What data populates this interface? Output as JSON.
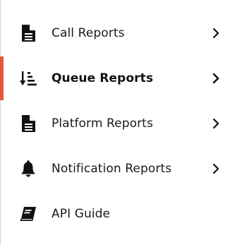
{
  "sidebar": {
    "active_color": "#e8563a",
    "items": [
      {
        "label": "Call Reports",
        "icon": "document-icon",
        "has_submenu": true,
        "active": false
      },
      {
        "label": "Queue Reports",
        "icon": "sort-descending-icon",
        "has_submenu": true,
        "active": true
      },
      {
        "label": "Platform Reports",
        "icon": "document-icon",
        "has_submenu": true,
        "active": false
      },
      {
        "label": "Notification Reports",
        "icon": "bell-icon",
        "has_submenu": true,
        "active": false
      },
      {
        "label": "API Guide",
        "icon": "book-icon",
        "has_submenu": false,
        "active": false
      }
    ]
  }
}
